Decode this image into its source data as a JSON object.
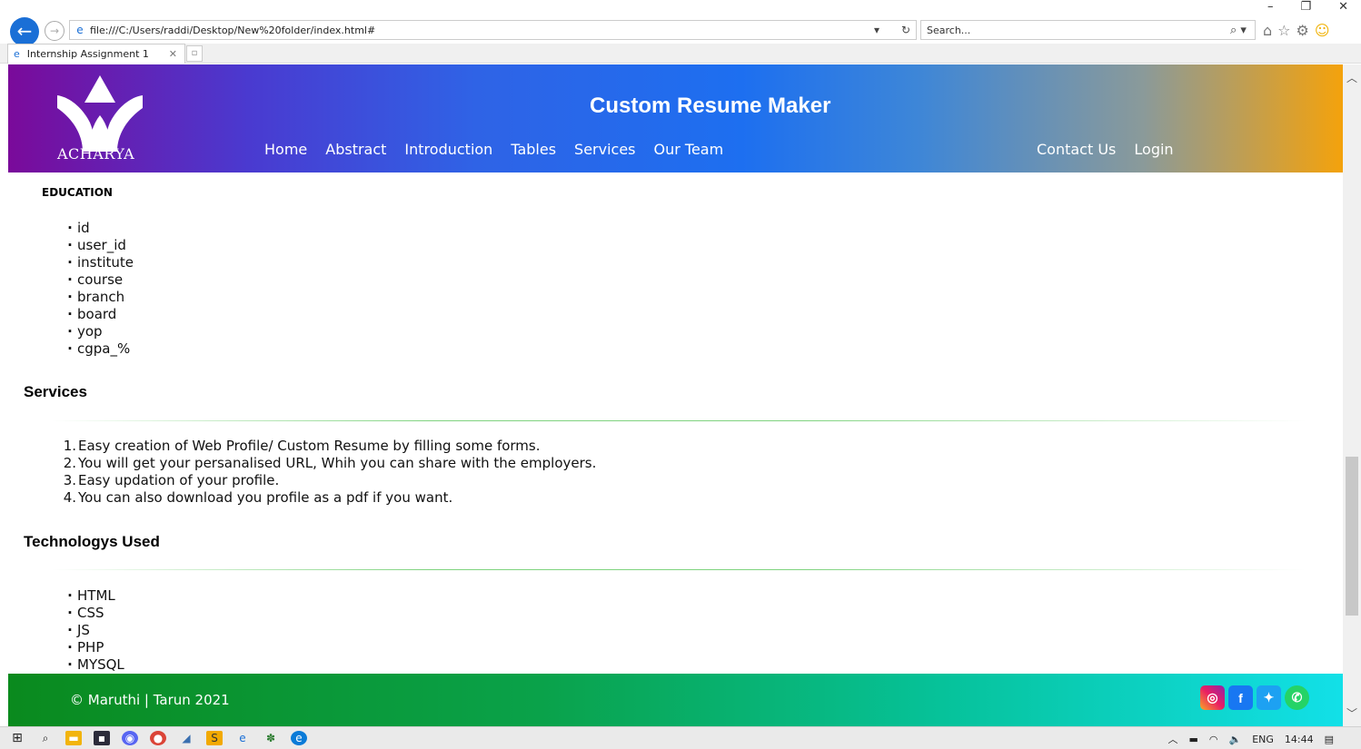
{
  "browser": {
    "url": "file:///C:/Users/raddi/Desktop/New%20folder/index.html#",
    "search_placeholder": "Search...",
    "tab_title": "Internship Assignment 1",
    "win_minimize": "–",
    "win_restore": "❐",
    "win_close": "✕"
  },
  "header": {
    "logo_text": "ACHARYA",
    "title": "Custom Resume Maker",
    "nav": [
      "Home",
      "Abstract",
      "Introduction",
      "Tables",
      "Services",
      "Our Team"
    ],
    "nav_right": [
      "Contact Us",
      "Login"
    ]
  },
  "education": {
    "title": "EDUCATION",
    "items": [
      "id",
      "user_id",
      "institute",
      "course",
      "branch",
      "board",
      "yop",
      "cgpa_%"
    ]
  },
  "services": {
    "title": "Services",
    "items": [
      "Easy creation of Web Profile/ Custom Resume by filling some forms.",
      "You will get your persanalised URL, Whih you can share with the employers.",
      "Easy updation of your profile.",
      "You can also download you profile as a pdf if you want."
    ]
  },
  "technologies": {
    "title": "Technologys Used",
    "items": [
      "HTML",
      "CSS",
      "JS",
      "PHP",
      "MYSQL"
    ]
  },
  "footer": {
    "copyright": "© Maruthi | Tarun 2021",
    "social": [
      "instagram-icon",
      "facebook-icon",
      "twitter-icon",
      "whatsapp-icon"
    ]
  },
  "taskbar": {
    "language": "ENG",
    "time": "14:44"
  },
  "colors": {
    "header_start": "#7a0a9a",
    "header_mid": "#1d6ff0",
    "header_end": "#f4a20c",
    "footer_start": "#0a8a1e",
    "footer_end": "#12e0e8",
    "divider": "#7fd37f"
  }
}
